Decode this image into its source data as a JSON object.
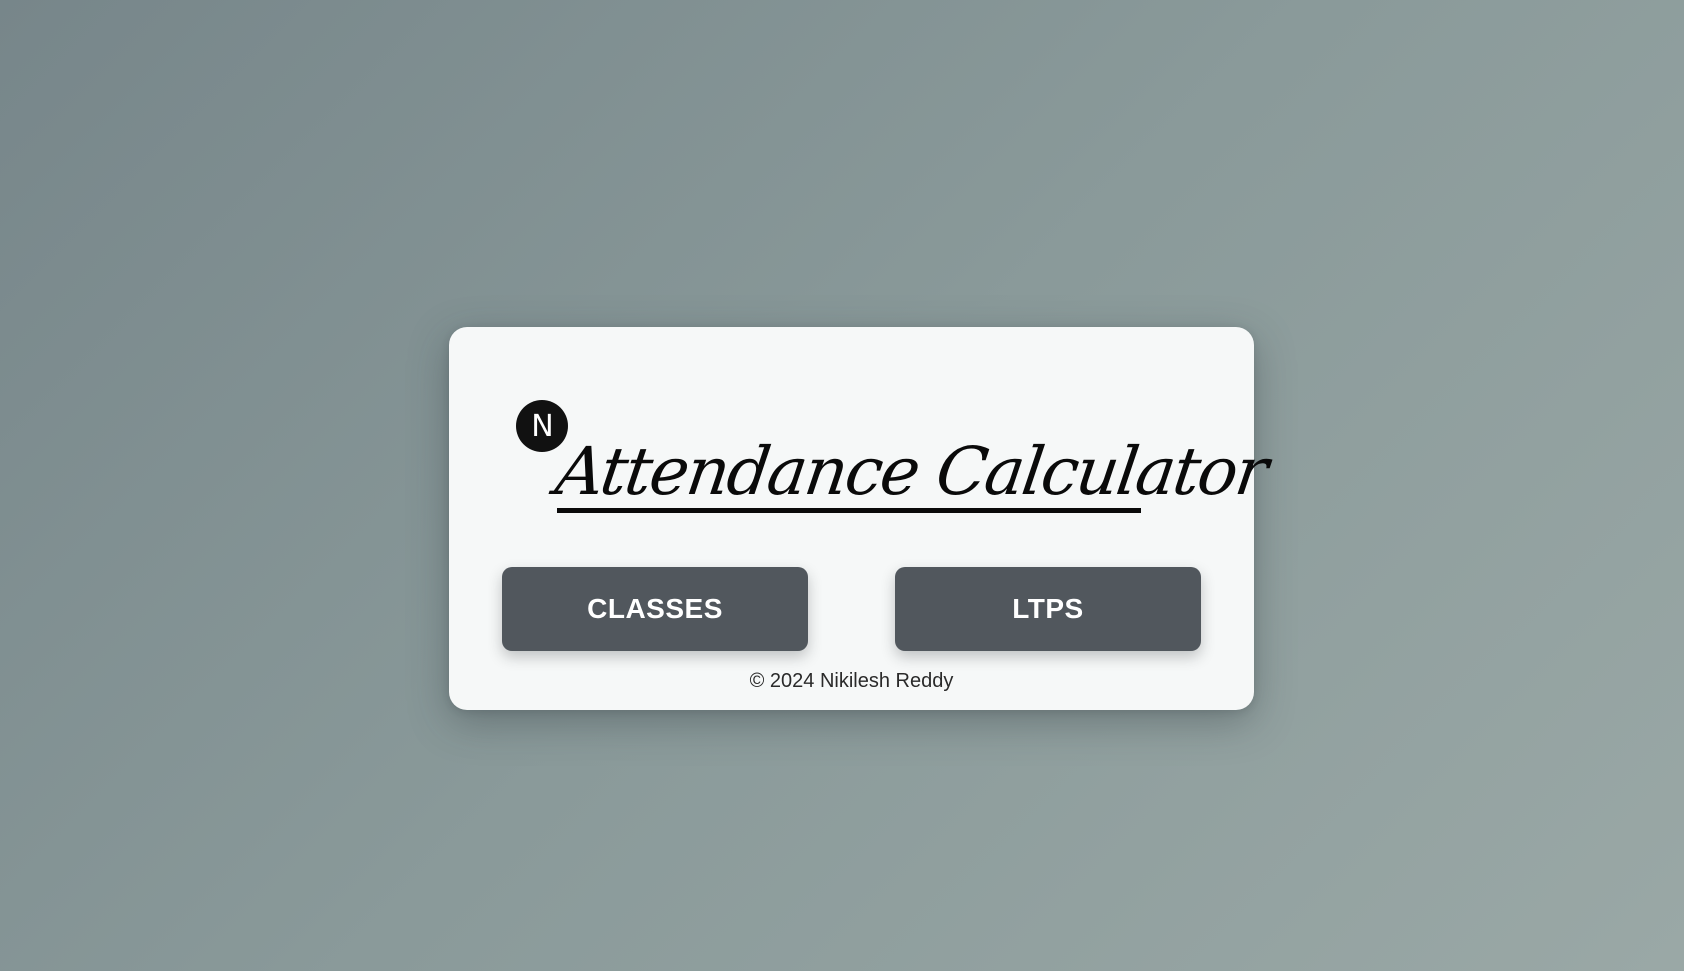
{
  "card": {
    "logo_letter": "N",
    "title": "Attendance Calculator",
    "buttons": {
      "classes_label": "CLASSES",
      "ltps_label": "LTPS"
    },
    "footer": "© 2024 Nikilesh Reddy"
  },
  "colors": {
    "background_start": "#77868a",
    "background_end": "#9aa8a6",
    "card_background": "#f6f8f8",
    "button_background": "#51575d",
    "button_text": "#ffffff",
    "title_text": "#0a0a0a"
  }
}
